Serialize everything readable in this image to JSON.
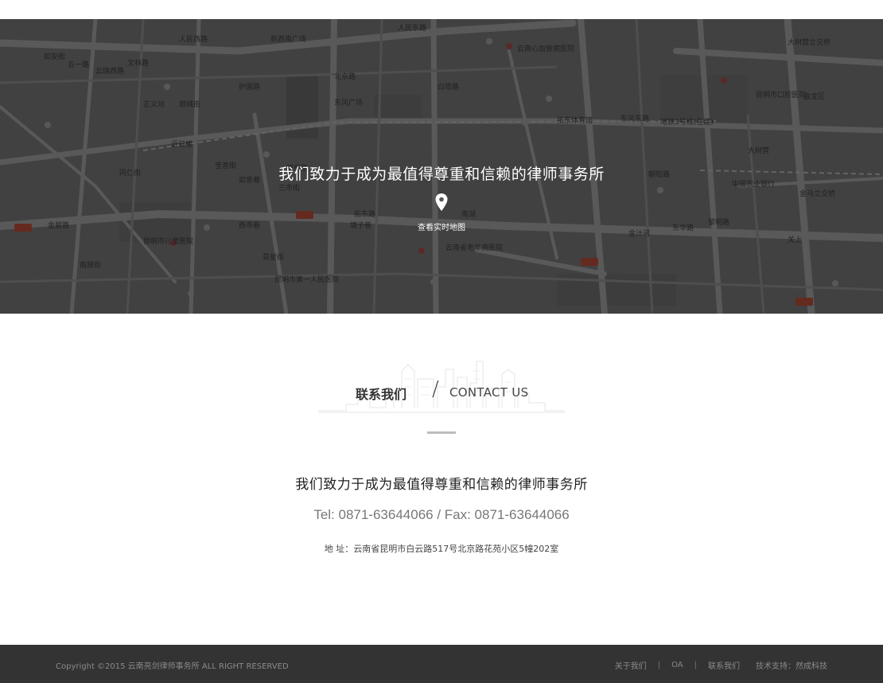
{
  "hero": {
    "slogan": "我们致力于成为最值得尊重和信赖的律师事务所",
    "map_link": "查看实时地图",
    "map_labels": [
      "人民西路",
      "新西南广场",
      "人民东路",
      "云南心血管病医院",
      "大树营立交桥",
      "如安街",
      "五一路",
      "云瑞西路",
      "文林路",
      "东风广场",
      "北京路",
      "白塔路",
      "盘龙区",
      "拓东体育馆",
      "东风东路",
      "地铁3号线(在建)",
      "昆明市口腔医院",
      "正义坊",
      "近日楼",
      "三市街",
      "拓东路",
      "宝善街",
      "桥东路",
      "昆明市儿童医院",
      "景星街",
      "昆明市第一人民医院",
      "南屏街",
      "西寺巷",
      "金碧路",
      "护国路",
      "顺城街",
      "云南省老年病医院",
      "金马立交桥",
      "大树营",
      "中国农业银行",
      "金汁河",
      "朝阳路",
      "东华路",
      "黎明路",
      "关上",
      "如意巷",
      "塘子巷",
      "南湖",
      "同仁街"
    ]
  },
  "contact": {
    "title_cn": "联系我们",
    "title_en": "CONTACT US",
    "slogan": "我们致力于成为最值得尊重和信赖的律师事务所",
    "phone_line": "Tel: 0871-63644066 / Fax: 0871-63644066",
    "address": "地 址：云南省昆明市白云路517号北京路花苑小区5幢202室"
  },
  "footer": {
    "copyright": "Copyright ©2015 云南亮剑律师事务所 ALL RIGHT RESERVED",
    "nav": [
      "关于我们",
      "OA",
      "联系我们"
    ],
    "separator": "|",
    "tech_support": "技术支持：然成科技"
  },
  "colors": {
    "map_base": "#5a5a5a",
    "footer_bg": "#333333",
    "divider": "#bdbdbd"
  }
}
